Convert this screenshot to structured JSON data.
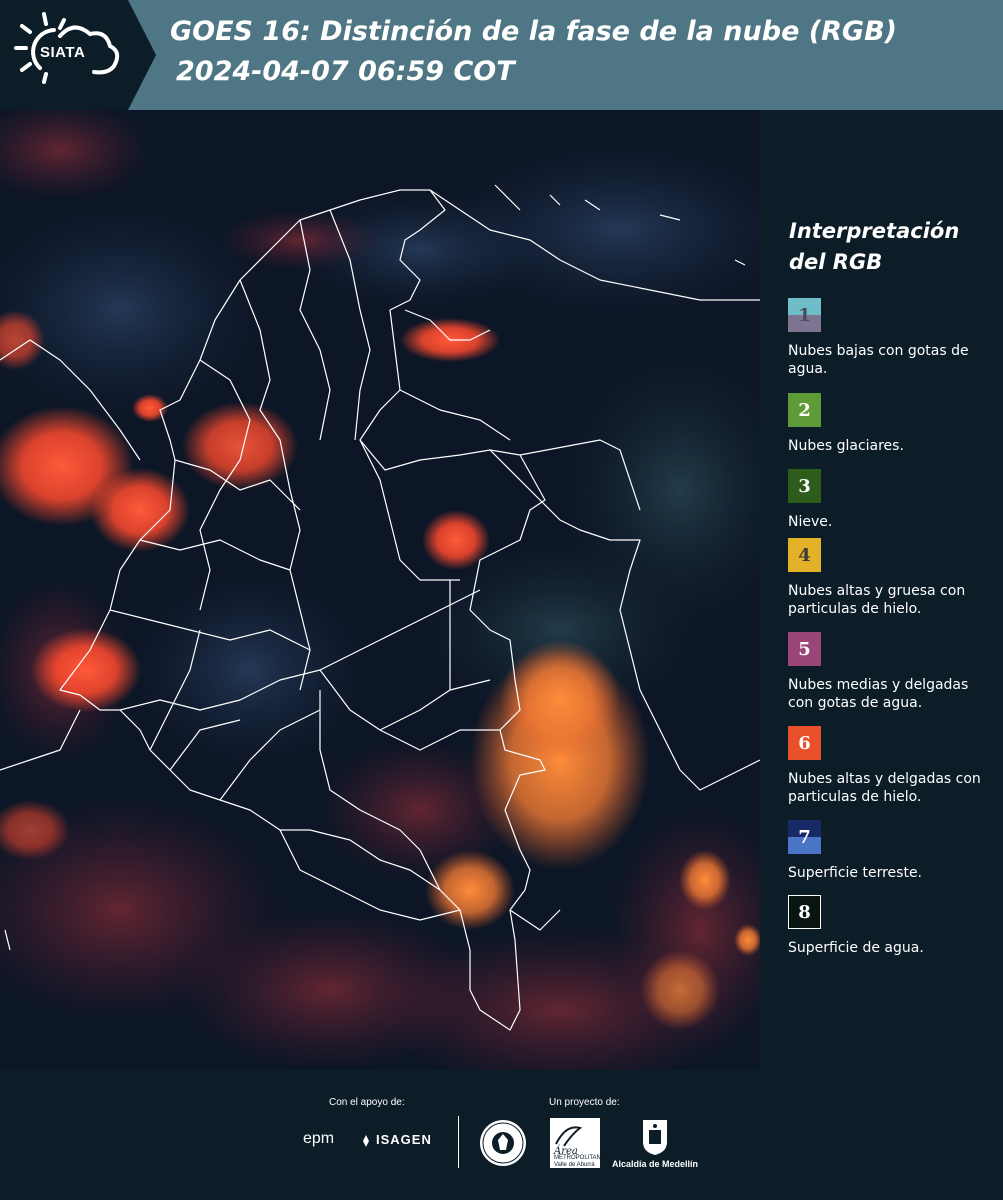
{
  "header": {
    "logo_text": "SIATA",
    "title": "GOES 16: Distinción de la fase de la nube (RGB)",
    "timestamp": "2024-04-07 06:59 COT"
  },
  "legend": {
    "title": "Interpretación del RGB",
    "items": [
      {
        "number": "1",
        "label": "Nubes bajas con gotas de agua.",
        "color_top": "#6fbdc8",
        "color_bottom": "#7c7490",
        "text_color": "#4a4a5c"
      },
      {
        "number": "2",
        "label": "Nubes glaciares.",
        "color_top": "#5e9a36",
        "color_bottom": "#5e9a36",
        "text_color": "#ffffff"
      },
      {
        "number": "3",
        "label": "Nieve.",
        "color_top": "#2e5c1b",
        "color_bottom": "#2e5c1b",
        "text_color": "#ffffff"
      },
      {
        "number": "4",
        "label": "Nubes altas y gruesa con particulas de hielo.",
        "color_top": "#e2b127",
        "color_bottom": "#e2b127",
        "text_color": "#3b3b3b"
      },
      {
        "number": "5",
        "label": "Nubes medias y delgadas con gotas de agua.",
        "color_top": "#9b4679",
        "color_bottom": "#9b4679",
        "text_color": "#ffffff"
      },
      {
        "number": "6",
        "label": "Nubes altas y delgadas con particulas de hielo.",
        "color_top": "#e84f2b",
        "color_bottom": "#e84f2b",
        "text_color": "#ffffff"
      },
      {
        "number": "7",
        "label": "Superficie terreste.",
        "color_top": "#172a66",
        "color_bottom": "#4a74c6",
        "text_color": "#ffffff"
      },
      {
        "number": "8",
        "label": "Superficie de agua.",
        "color_top": "#0a1410",
        "color_bottom": "#0a1410",
        "text_color": "#ffffff"
      }
    ]
  },
  "footer": {
    "support_label": "Con el apoyo de:",
    "project_label": "Un proyecto de:",
    "epm": "epm",
    "isagen": "ISAGEN",
    "area_text": "Área",
    "area_subtext": "METROPOLITANA Valle de Aburrá",
    "alcaldia": "Alcaldía de Medellín"
  },
  "colors": {
    "header_bg": "#4f7684",
    "page_bg": "#0c1d28",
    "cloud_red": "#ff4a2e",
    "cloud_orange": "#ff7a33",
    "map_dark": "#0d1626",
    "border_white": "#ffffff"
  }
}
